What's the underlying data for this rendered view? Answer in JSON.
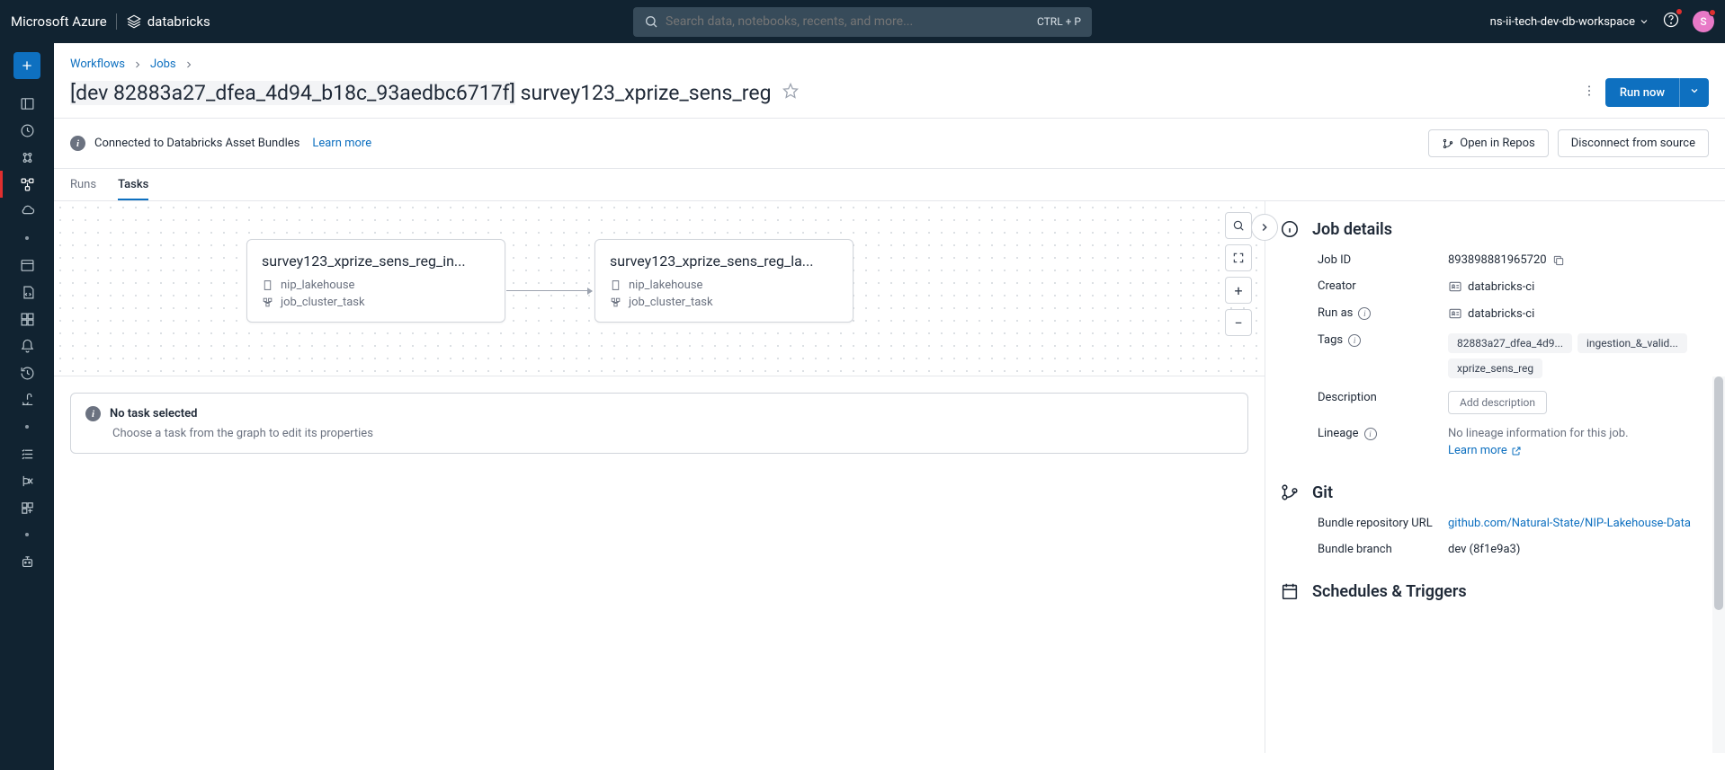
{
  "header": {
    "brand_azure": "Microsoft Azure",
    "brand_databricks": "databricks",
    "search_placeholder": "Search data, notebooks, recents, and more...",
    "search_shortcut": "CTRL + P",
    "workspace": "ns-ii-tech-dev-db-workspace",
    "avatar_letter": "S"
  },
  "breadcrumb": {
    "items": [
      "Workflows",
      "Jobs"
    ]
  },
  "job": {
    "prefix": "[dev 82883a27_dfea_4d94_b18c_93aedbc6717f]",
    "name": "survey123_xprize_sens_reg",
    "run_now": "Run now"
  },
  "bundle": {
    "text": "Connected to Databricks Asset Bundles",
    "learn_more": "Learn more",
    "open_repos": "Open in Repos",
    "disconnect": "Disconnect from source"
  },
  "tabs": {
    "runs": "Runs",
    "tasks": "Tasks"
  },
  "tasks": [
    {
      "title": "survey123_xprize_sens_reg_in...",
      "source": "nip_lakehouse",
      "cluster": "job_cluster_task"
    },
    {
      "title": "survey123_xprize_sens_reg_la...",
      "source": "nip_lakehouse",
      "cluster": "job_cluster_task"
    }
  ],
  "no_task": {
    "title": "No task selected",
    "sub": "Choose a task from the graph to edit its properties"
  },
  "details": {
    "title": "Job details",
    "job_id_label": "Job ID",
    "job_id": "893898881965720",
    "creator_label": "Creator",
    "creator": "databricks-ci",
    "run_as_label": "Run as",
    "run_as": "databricks-ci",
    "tags_label": "Tags",
    "tags": [
      "82883a27_dfea_4d9...",
      "ingestion_&_valid...",
      "xprize_sens_reg"
    ],
    "description_label": "Description",
    "add_description": "Add description",
    "lineage_label": "Lineage",
    "lineage_text": "No lineage information for this job.",
    "lineage_learn_more": "Learn more"
  },
  "git": {
    "title": "Git",
    "repo_label": "Bundle repository URL",
    "repo_url": "github.com/Natural-State/NIP-Lakehouse-Data",
    "branch_label": "Bundle branch",
    "branch": "dev (8f1e9a3)"
  },
  "schedules": {
    "title": "Schedules & Triggers"
  }
}
